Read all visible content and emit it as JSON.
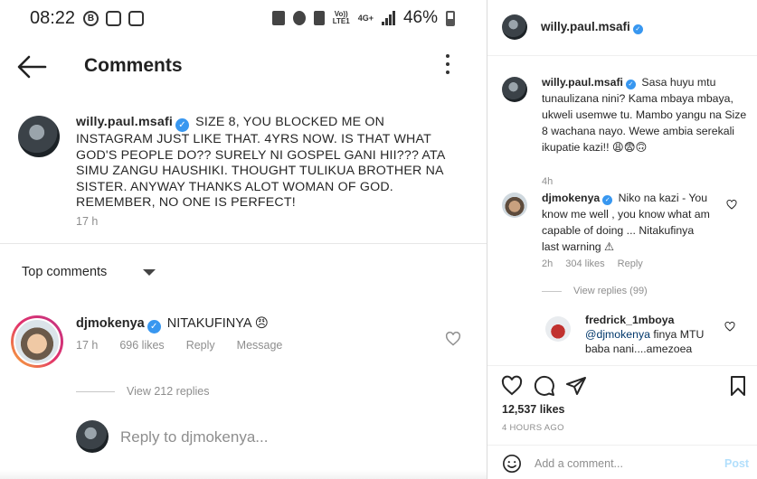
{
  "phone": {
    "status": {
      "time": "08:22",
      "network_top": "Vo))",
      "network_bottom": "LTE1",
      "data_type": "4G+",
      "battery_pct": "46%"
    },
    "appbar": {
      "title": "Comments"
    },
    "caption": {
      "username": "willy.paul.msafi",
      "text": "SIZE 8, YOU BLOCKED ME ON INSTAGRAM JUST LIKE THAT. 4YRS NOW. IS THAT WHAT GOD'S PEOPLE DO?? SURELY NI GOSPEL GANI HII??? ATA SIMU ZANGU HAUSHIKI. THOUGHT TULIKUA BROTHER NA SISTER. ANYWAY THANKS ALOT WOMAN OF GOD. REMEMBER,  NO ONE IS PERFECT!",
      "time": "17 h"
    },
    "sort_label": "Top comments",
    "comment": {
      "username": "djmokenya",
      "text": "NITAKUFINYA 😠",
      "time": "17 h",
      "likes": "696 likes",
      "reply_label": "Reply",
      "message_label": "Message",
      "view_replies": "View 212 replies"
    },
    "reply_placeholder": "Reply to djmokenya..."
  },
  "panel": {
    "header": {
      "username": "willy.paul.msafi"
    },
    "caption": {
      "username": "willy.paul.msafi",
      "text": "Sasa huyu mtu tunaulizana nini? Kama mbaya mbaya, ukweli usemwe tu. Mambo yangu na Size 8 wachana nayo. Wewe ambia serekali ikupatie kazi!! 😩😨🙃",
      "time": "4h"
    },
    "comment": {
      "username": "djmokenya",
      "text": "Niko na kazi - You know me well , you know what am capable of doing ... Nitakufinya last warning ⚠",
      "time": "2h",
      "likes": "304 likes",
      "reply_label": "Reply",
      "view_replies": "View replies (99)"
    },
    "reply": {
      "username": "fredrick_1mboya",
      "mention": "@djmokenya",
      "text": "finya MTU baba nani....amezoea"
    },
    "likes": "12,537 likes",
    "post_time": "4 HOURS AGO",
    "add_comment_placeholder": "Add a comment...",
    "post_label": "Post"
  },
  "icons": [
    "back-arrow-icon",
    "more-options-icon",
    "verified-icon",
    "heart-icon",
    "comment-icon",
    "share-icon",
    "bookmark-icon",
    "smile-icon",
    "chevron-down-icon"
  ],
  "colors": {
    "verified": "#3897f0",
    "muted": "#8e8e8e",
    "post_disabled": "#b2dffc",
    "mention": "#00376b"
  }
}
